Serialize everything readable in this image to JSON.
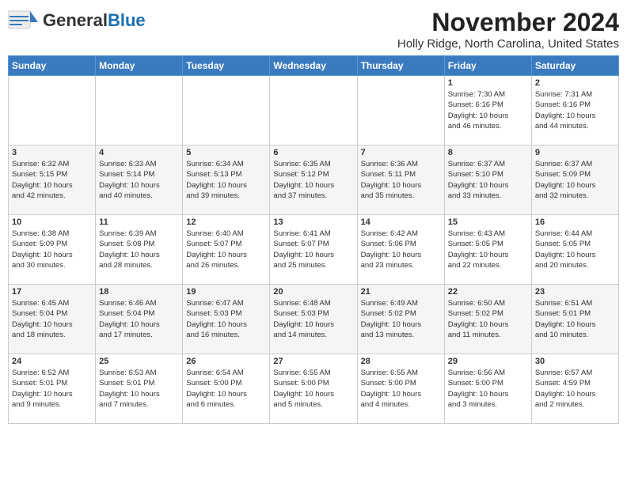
{
  "header": {
    "logo_general": "General",
    "logo_blue": "Blue",
    "month_title": "November 2024",
    "location": "Holly Ridge, North Carolina, United States"
  },
  "days_of_week": [
    "Sunday",
    "Monday",
    "Tuesday",
    "Wednesday",
    "Thursday",
    "Friday",
    "Saturday"
  ],
  "weeks": [
    [
      {
        "day": "",
        "info": ""
      },
      {
        "day": "",
        "info": ""
      },
      {
        "day": "",
        "info": ""
      },
      {
        "day": "",
        "info": ""
      },
      {
        "day": "",
        "info": ""
      },
      {
        "day": "1",
        "info": "Sunrise: 7:30 AM\nSunset: 6:16 PM\nDaylight: 10 hours\nand 46 minutes."
      },
      {
        "day": "2",
        "info": "Sunrise: 7:31 AM\nSunset: 6:16 PM\nDaylight: 10 hours\nand 44 minutes."
      }
    ],
    [
      {
        "day": "3",
        "info": "Sunrise: 6:32 AM\nSunset: 5:15 PM\nDaylight: 10 hours\nand 42 minutes."
      },
      {
        "day": "4",
        "info": "Sunrise: 6:33 AM\nSunset: 5:14 PM\nDaylight: 10 hours\nand 40 minutes."
      },
      {
        "day": "5",
        "info": "Sunrise: 6:34 AM\nSunset: 5:13 PM\nDaylight: 10 hours\nand 39 minutes."
      },
      {
        "day": "6",
        "info": "Sunrise: 6:35 AM\nSunset: 5:12 PM\nDaylight: 10 hours\nand 37 minutes."
      },
      {
        "day": "7",
        "info": "Sunrise: 6:36 AM\nSunset: 5:11 PM\nDaylight: 10 hours\nand 35 minutes."
      },
      {
        "day": "8",
        "info": "Sunrise: 6:37 AM\nSunset: 5:10 PM\nDaylight: 10 hours\nand 33 minutes."
      },
      {
        "day": "9",
        "info": "Sunrise: 6:37 AM\nSunset: 5:09 PM\nDaylight: 10 hours\nand 32 minutes."
      }
    ],
    [
      {
        "day": "10",
        "info": "Sunrise: 6:38 AM\nSunset: 5:09 PM\nDaylight: 10 hours\nand 30 minutes."
      },
      {
        "day": "11",
        "info": "Sunrise: 6:39 AM\nSunset: 5:08 PM\nDaylight: 10 hours\nand 28 minutes."
      },
      {
        "day": "12",
        "info": "Sunrise: 6:40 AM\nSunset: 5:07 PM\nDaylight: 10 hours\nand 26 minutes."
      },
      {
        "day": "13",
        "info": "Sunrise: 6:41 AM\nSunset: 5:07 PM\nDaylight: 10 hours\nand 25 minutes."
      },
      {
        "day": "14",
        "info": "Sunrise: 6:42 AM\nSunset: 5:06 PM\nDaylight: 10 hours\nand 23 minutes."
      },
      {
        "day": "15",
        "info": "Sunrise: 6:43 AM\nSunset: 5:05 PM\nDaylight: 10 hours\nand 22 minutes."
      },
      {
        "day": "16",
        "info": "Sunrise: 6:44 AM\nSunset: 5:05 PM\nDaylight: 10 hours\nand 20 minutes."
      }
    ],
    [
      {
        "day": "17",
        "info": "Sunrise: 6:45 AM\nSunset: 5:04 PM\nDaylight: 10 hours\nand 18 minutes."
      },
      {
        "day": "18",
        "info": "Sunrise: 6:46 AM\nSunset: 5:04 PM\nDaylight: 10 hours\nand 17 minutes."
      },
      {
        "day": "19",
        "info": "Sunrise: 6:47 AM\nSunset: 5:03 PM\nDaylight: 10 hours\nand 16 minutes."
      },
      {
        "day": "20",
        "info": "Sunrise: 6:48 AM\nSunset: 5:03 PM\nDaylight: 10 hours\nand 14 minutes."
      },
      {
        "day": "21",
        "info": "Sunrise: 6:49 AM\nSunset: 5:02 PM\nDaylight: 10 hours\nand 13 minutes."
      },
      {
        "day": "22",
        "info": "Sunrise: 6:50 AM\nSunset: 5:02 PM\nDaylight: 10 hours\nand 11 minutes."
      },
      {
        "day": "23",
        "info": "Sunrise: 6:51 AM\nSunset: 5:01 PM\nDaylight: 10 hours\nand 10 minutes."
      }
    ],
    [
      {
        "day": "24",
        "info": "Sunrise: 6:52 AM\nSunset: 5:01 PM\nDaylight: 10 hours\nand 9 minutes."
      },
      {
        "day": "25",
        "info": "Sunrise: 6:53 AM\nSunset: 5:01 PM\nDaylight: 10 hours\nand 7 minutes."
      },
      {
        "day": "26",
        "info": "Sunrise: 6:54 AM\nSunset: 5:00 PM\nDaylight: 10 hours\nand 6 minutes."
      },
      {
        "day": "27",
        "info": "Sunrise: 6:55 AM\nSunset: 5:00 PM\nDaylight: 10 hours\nand 5 minutes."
      },
      {
        "day": "28",
        "info": "Sunrise: 6:55 AM\nSunset: 5:00 PM\nDaylight: 10 hours\nand 4 minutes."
      },
      {
        "day": "29",
        "info": "Sunrise: 6:56 AM\nSunset: 5:00 PM\nDaylight: 10 hours\nand 3 minutes."
      },
      {
        "day": "30",
        "info": "Sunrise: 6:57 AM\nSunset: 4:59 PM\nDaylight: 10 hours\nand 2 minutes."
      }
    ]
  ]
}
